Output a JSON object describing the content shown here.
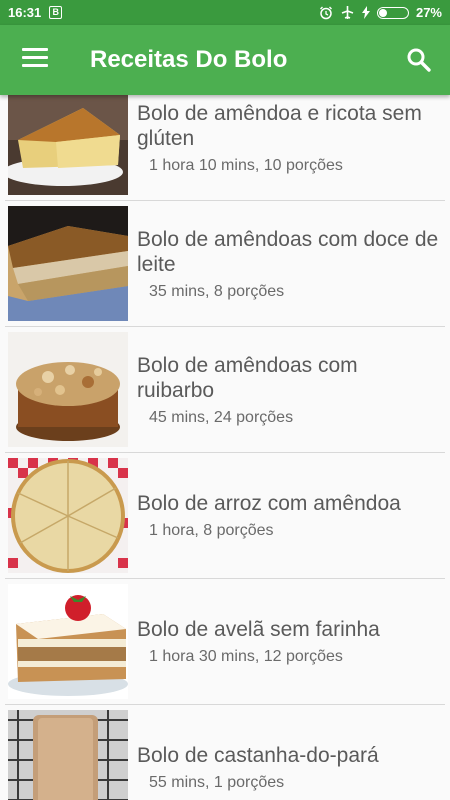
{
  "status_bar": {
    "time": "16:31",
    "notification_letter": "B",
    "battery_percent": "27%",
    "battery_level": 0.27
  },
  "app_bar": {
    "title": "Receitas Do Bolo"
  },
  "recipes": [
    {
      "name": "Bolo de amêndoa e ricota sem glúten",
      "meta": "1 hora 10 mins, 10 porções"
    },
    {
      "name": "Bolo de amêndoas com doce de leite",
      "meta": "35 mins, 8 porções"
    },
    {
      "name": "Bolo de amêndoas com ruibarbo",
      "meta": "45 mins, 24 porções"
    },
    {
      "name": "Bolo de arroz com amêndoa",
      "meta": "1 hora, 8 porções"
    },
    {
      "name": "Bolo de avelã sem farinha",
      "meta": "1 hora 30 mins, 12 porções"
    },
    {
      "name": "Bolo de castanha-do-pará",
      "meta": "55 mins, 1 porções"
    }
  ],
  "colors": {
    "status_bar": "#3a9a3e",
    "app_bar": "#4caf50",
    "background": "#fafafa"
  }
}
